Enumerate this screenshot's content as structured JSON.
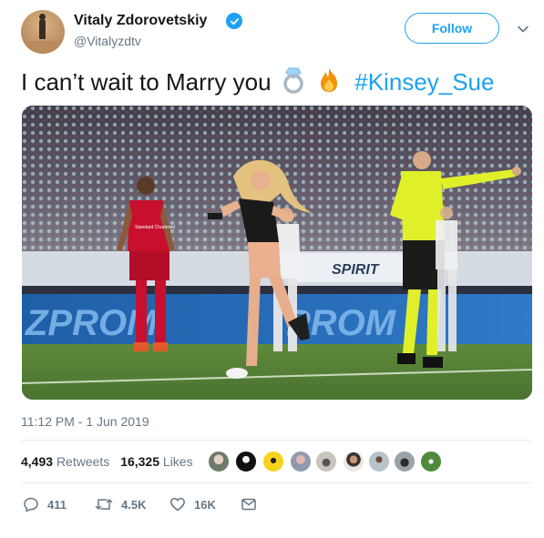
{
  "author": {
    "name": "Vitaly Zdorovetskiy",
    "handle": "@Vitalyzdtv",
    "verified": true
  },
  "follow_label": "Follow",
  "tweet": {
    "text": "I can’t wait to Marry you",
    "emojis": [
      "ring-emoji",
      "fire-emoji"
    ],
    "hashtag": "#Kinsey_Sue"
  },
  "photo": {
    "banner_left": "ZPROM",
    "banner_right": "PROM",
    "advertising_board": "SPIRIT",
    "jersey_sponsor": "Standard Chartered"
  },
  "timestamp": "11:12 PM - 1 Jun 2019",
  "stats": {
    "retweets_count": "4,493",
    "retweets_label": "Retweets",
    "likes_count": "16,325",
    "likes_label": "Likes"
  },
  "likers": [
    "avatar-1",
    "avatar-2",
    "avatar-3",
    "avatar-4",
    "avatar-5",
    "avatar-6",
    "avatar-7",
    "avatar-8",
    "avatar-9"
  ],
  "actions": {
    "replies": "411",
    "retweets": "4.5K",
    "likes": "16K"
  },
  "colors": {
    "accent": "#1da1f2",
    "text": "#14171a",
    "secondary": "#657786",
    "divider": "#e6ecf0"
  }
}
